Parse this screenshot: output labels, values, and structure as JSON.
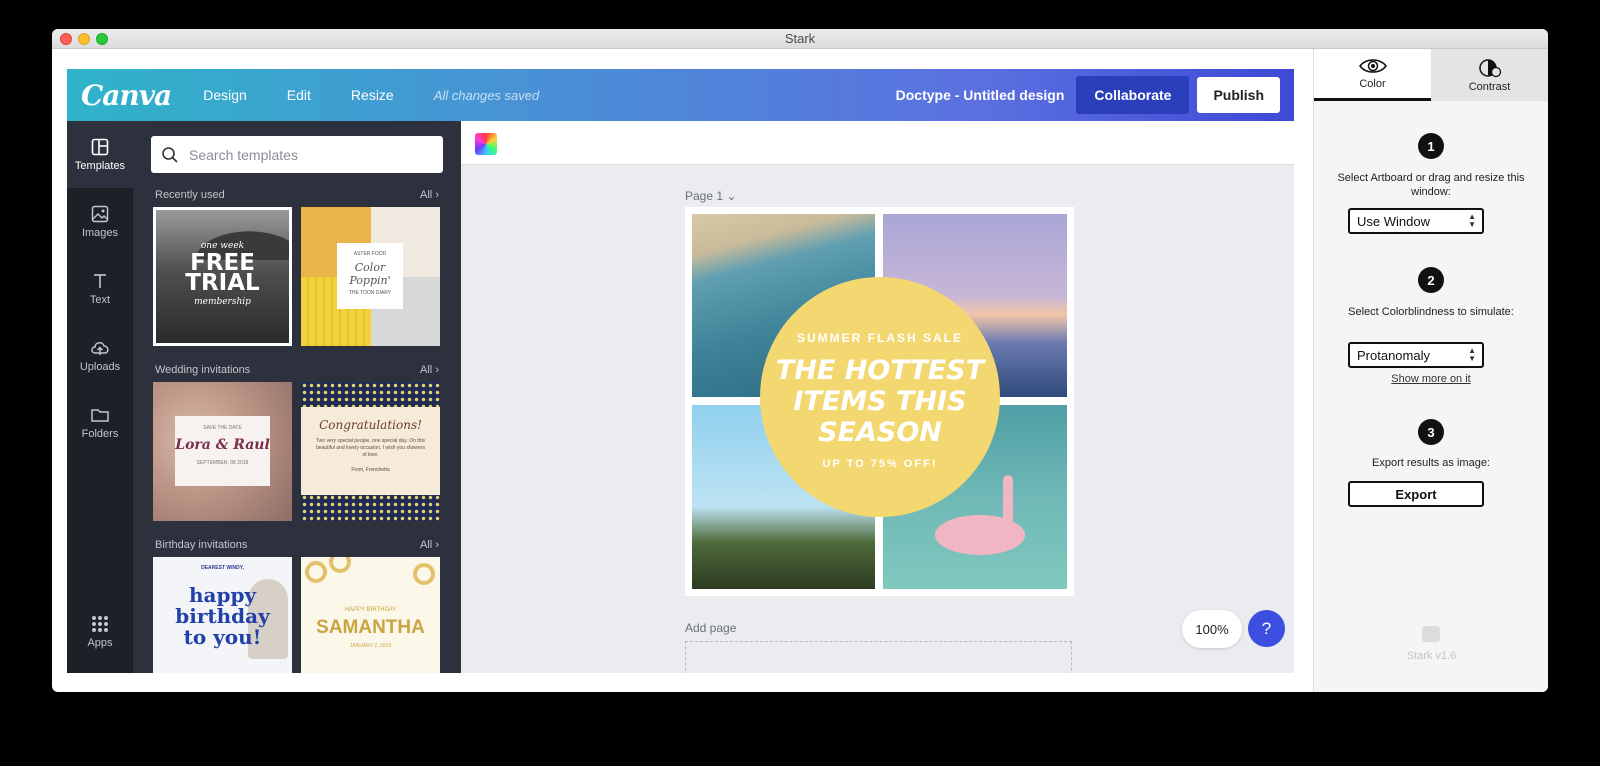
{
  "window": {
    "title": "Stark"
  },
  "canva": {
    "logo": "Canva",
    "nav": [
      "Design",
      "Edit",
      "Resize"
    ],
    "saved_status": "All changes saved",
    "doc_title": "Doctype - Untitled design",
    "collaborate_label": "Collaborate",
    "publish_label": "Publish"
  },
  "sidenav": {
    "items": [
      {
        "label": "Templates",
        "icon": "templates-icon"
      },
      {
        "label": "Images",
        "icon": "image-icon"
      },
      {
        "label": "Text",
        "icon": "text-icon"
      },
      {
        "label": "Uploads",
        "icon": "upload-icon"
      },
      {
        "label": "Folders",
        "icon": "folder-icon"
      }
    ],
    "apps_label": "Apps"
  },
  "panel": {
    "search_placeholder": "Search templates",
    "sections": [
      {
        "title": "Recently used",
        "all": "All"
      },
      {
        "title": "Wedding invitations",
        "all": "All"
      },
      {
        "title": "Birthday invitations",
        "all": "All"
      }
    ],
    "templates": {
      "free_trial": {
        "small": "one week",
        "big1": "FREE",
        "big2": "TRIAL",
        "sub": "membership"
      },
      "color_poppin": {
        "top": "ASTER FOOD",
        "script1": "Color",
        "script2": "Poppin'",
        "bottom": "THE TOON DIARY"
      },
      "wedding": {
        "top": "SAVE THE DATE",
        "names": "Lora & Raul",
        "date": "SEPTEMBER, 08 2018"
      },
      "congrats": {
        "title": "Congratulations!",
        "body": "Two very special people, one special day. On this beautiful and lovely occasion, I wish you showers of love.",
        "sign": "From, Frenchetta"
      },
      "birthday1": {
        "top": "DEAREST WINDY,",
        "l1": "happy",
        "l2": "birthday",
        "l3": "to you!"
      },
      "birthday2": {
        "top": "HAPPY BIRTHDAY",
        "name": "SAMANTHA",
        "date": "JANUARY 2, 2019"
      }
    }
  },
  "editor": {
    "page_label": "Page 1",
    "add_page_label": "Add page",
    "zoom": "100%",
    "help": "?",
    "design": {
      "kicker": "SUMMER FLASH SALE",
      "headline1": "THE HOTTEST",
      "headline2": "ITEMS THIS",
      "headline3": "SEASON",
      "sub": "UP TO 75% OFF!",
      "circle_color": "#f3d872"
    }
  },
  "stark": {
    "tabs": [
      "Color",
      "Contrast"
    ],
    "step1": {
      "num": "1",
      "text": "Select Artboard or drag and resize this window:",
      "select": "Use Window"
    },
    "step2": {
      "num": "2",
      "text": "Select Colorblindness to simulate:",
      "select": "Protanomaly",
      "link": "Show more on it"
    },
    "step3": {
      "num": "3",
      "text": "Export results as image:",
      "button": "Export"
    },
    "version": "Stark v1.6"
  }
}
